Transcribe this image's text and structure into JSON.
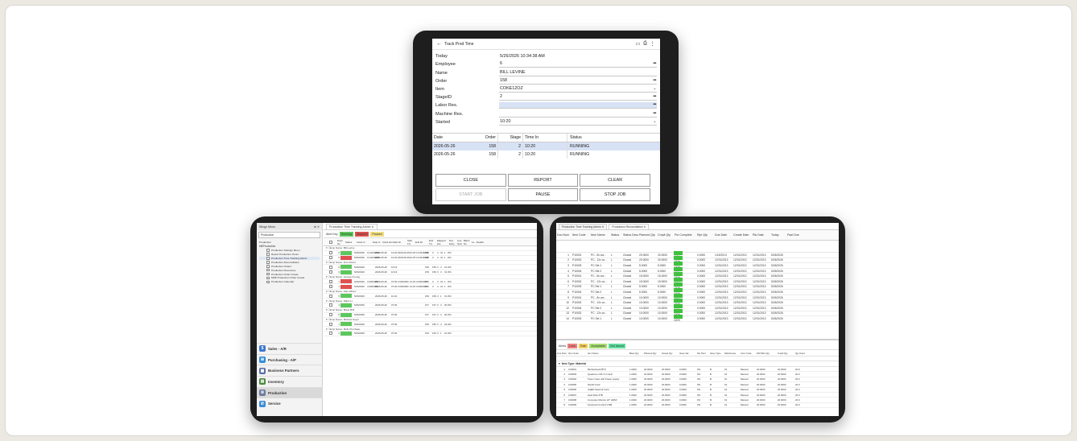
{
  "top_tablet": {
    "title": "Track Prod Time",
    "icons": [
      "barcode-icon",
      "print-icon",
      "more-vertical-icon"
    ],
    "fields": [
      {
        "label": "Today",
        "value": "5/26/2026 10:34:38 AM",
        "suffix": "",
        "style": "plain"
      },
      {
        "label": "Employee",
        "value": "6",
        "suffix": "•••",
        "style": "line"
      },
      {
        "label": "Name",
        "value": "BILL LEVINE",
        "suffix": "",
        "style": "line"
      },
      {
        "label": "Order",
        "value": "158",
        "suffix": "•••",
        "style": "line"
      },
      {
        "label": "Item",
        "value": "COKE12OZ",
        "suffix": "⌄",
        "style": "line"
      },
      {
        "label": "StageID",
        "value": "2",
        "suffix": "•••",
        "style": "line"
      },
      {
        "label": "Labor Res.",
        "value": "",
        "suffix": "•••",
        "style": "hl"
      },
      {
        "label": "Machine Res.",
        "value": "",
        "suffix": "•••",
        "style": "line"
      },
      {
        "label": "Started",
        "value": "10:20",
        "suffix": "⌄",
        "style": "line"
      }
    ],
    "grid": {
      "headers": [
        "Date",
        "Order",
        "Stage",
        "Time In",
        "Status"
      ],
      "rows": [
        [
          "2026-05-26",
          "158",
          "2",
          "10:20",
          "RUNNING"
        ],
        [
          "2026-05-26",
          "158",
          "2",
          "10:20",
          "RUNNING"
        ]
      ]
    },
    "buttons": [
      "CLOSE",
      "REPORT",
      "CLEAR",
      "START JOB",
      "PAUSE",
      "STOP JOB"
    ]
  },
  "left_tablet": {
    "sidebar_title": "Wizgo Menu",
    "sidebar_controls": "⊕ ✕",
    "module_label": "Production",
    "tree_caption": "Production",
    "tree_root": "Production",
    "tree_items": [
      "Production Settings Menu",
      "Report Production Hours",
      "Production Time Tracking Admin",
      "Production Reconciliation",
      "Production Orders",
      "Production Resources",
      "Production Order Create",
      "MRP Production Order Create",
      "Production Calendar"
    ],
    "modules": [
      {
        "label": "Sales - A/R",
        "color": "#3c78c8",
        "glyph": "$"
      },
      {
        "label": "Purchasing - A/P",
        "color": "#2f8ad8",
        "glyph": "⊞"
      },
      {
        "label": "Business Partners",
        "color": "#5b6fa8",
        "glyph": "▦"
      },
      {
        "label": "Inventory",
        "color": "#4a8a3a",
        "glyph": "▤"
      },
      {
        "label": "Production",
        "color": "#6a7c9c",
        "glyph": "⚙"
      },
      {
        "label": "Service",
        "color": "#3a8ad8",
        "glyph": "✆"
      }
    ],
    "tab": "Production Time Tracking Admin",
    "alert_key": "Alert Key",
    "chips": [
      {
        "label": "Running",
        "color": "#5cc85c"
      },
      {
        "label": "Stopped",
        "color": "#e05050"
      },
      {
        "label": "Paused",
        "color": "#f0e080"
      }
    ],
    "headers": [
      "Empl No",
      "Status",
      "Clock In",
      "Date In",
      "Clock Hrs",
      "Start Dt",
      "Start Tm",
      "End Dt",
      "End Tm",
      "Elapsed Hrs",
      "Doc Entry",
      "Line Num",
      "Batch No",
      "Lo...",
      "Dept",
      "Te"
    ],
    "groups": [
      {
        "name": "Emp Name: Bill Levine",
        "rows": [
          {
            "no": "6",
            "status": "#5cc85c",
            "f": [
              "5/26/2026",
              "0.24446000",
              "2026-05-26",
              "10:20",
              "2026-05-26",
              "10:25",
              "0.24446000",
              "158",
              "3",
              "4",
              "31",
              "1",
              "WC"
            ]
          },
          {
            "no": "6",
            "status": "#e05050",
            "f": [
              "5/26/2026",
              "0.24446000",
              "2026-05-26",
              "10:20",
              "2026-05-26",
              "10:25",
              "0.24446000",
              "158",
              "3",
              "4",
              "31",
              "1",
              "WC"
            ]
          }
        ]
      },
      {
        "name": "Emp Name: Fred Rocco",
        "rows": [
          {
            "no": "9",
            "status": "#5cc85c",
            "f": [
              "5/26/2026",
              "",
              "2026-05-26",
              "10:19",
              "",
              "",
              "",
              "159",
              "159",
              "3",
              "4",
              "31",
              "WC"
            ]
          },
          {
            "no": "9",
            "status": "#5cc85c",
            "f": [
              "5/26/2026",
              "",
              "2026-05-26",
              "10:19",
              "",
              "",
              "",
              "159",
              "159",
              "3",
              "4",
              "31",
              "WC"
            ]
          }
        ]
      },
      {
        "name": "Emp Name: George Koenig",
        "rows": [
          {
            "no": "1",
            "status": "#e05050",
            "f": [
              "5/26/2026",
              "3.0000000",
              "2026-05-26",
              "07:00",
              "3.0000000",
              "10:20",
              "3.0000000",
              "159",
              "3",
              "4",
              "31",
              "1",
              "WC"
            ]
          },
          {
            "no": "1",
            "status": "#e05050",
            "f": [
              "5/26/2026",
              "3.0000000",
              "2026-05-26",
              "07:00",
              "3.0000000",
              "10:20",
              "3.0000000",
              "159",
              "3",
              "4",
              "31",
              "1",
              "WC"
            ]
          }
        ]
      },
      {
        "name": "Emp Name: Kate Wilcox",
        "rows": [
          {
            "no": "5",
            "status": "#5cc85c",
            "f": [
              "5/26/2026",
              "",
              "2026-05-26",
              "10:24",
              "",
              "",
              "",
              "159",
              "159",
              "3",
              "1",
              "31",
              "WC"
            ]
          }
        ]
      },
      {
        "name": "Emp Name: Ralph H.",
        "rows": [
          {
            "no": "4",
            "status": "#5cc85c",
            "f": [
              "5/26/2026",
              "",
              "2026-05-26",
              "07:00",
              "",
              "",
              "",
              "157",
              "157",
              "3",
              "4",
              "30",
              "WC"
            ]
          }
        ]
      },
      {
        "name": "Emp Name: Marie Brill",
        "rows": [
          {
            "no": "8",
            "status": "#5cc85c",
            "f": [
              "5/26/2026",
              "",
              "2026-05-26",
              "07:00",
              "",
              "",
              "",
              "157",
              "157",
              "3",
              "4",
              "30",
              "WC"
            ]
          }
        ]
      },
      {
        "name": "Emp Name: Michael Geyer",
        "rows": [
          {
            "no": "1",
            "status": "#5cc85c",
            "f": [
              "5/26/2026",
              "",
              "2026-05-26",
              "07:00",
              "",
              "",
              "",
              "155",
              "155",
              "3",
              "4",
              "32",
              "WC"
            ]
          }
        ]
      },
      {
        "name": "Emp Name: Molly Purchase",
        "rows": [
          {
            "no": "2",
            "status": "#5cc85c",
            "f": [
              "5/26/2026",
              "",
              "2026-05-26",
              "07:00",
              "",
              "",
              "",
              "153",
              "153",
              "3",
              "1",
              "31",
              "WC"
            ]
          }
        ]
      }
    ]
  },
  "right_tablet": {
    "tabs": [
      "Production Time Tracking Admin",
      "Production Reconciliation"
    ],
    "headers": [
      "Doc Num",
      "Item Code",
      "Item Name",
      "Status",
      "Status Desc",
      "Planned Qty",
      "Cmplt Qty",
      "Pct Complete",
      "Rjct Qty",
      "Due Date",
      "Create Date",
      "Rls Date",
      "Today",
      "Past Due"
    ],
    "rows": [
      [
        "1",
        "P10001",
        "PC - 8x cor...",
        "L",
        "Closed",
        "20.0000",
        "20.0000",
        "100%",
        "0.0000",
        "1/15/2013",
        "12/31/2013",
        "12/31/2013",
        "5/26/2026",
        ""
      ],
      [
        "2",
        "P10002",
        "PC - 12x co...",
        "L",
        "Closed",
        "20.0000",
        "20.0000",
        "100%",
        "0.0000",
        "12/31/2013",
        "12/31/2013",
        "12/31/2013",
        "5/26/2026",
        ""
      ],
      [
        "3",
        "P10003",
        "PC Set 1",
        "L",
        "Closed",
        "5.0000",
        "5.0000",
        "100%",
        "0.0000",
        "12/31/2013",
        "12/31/2013",
        "12/31/2013",
        "5/26/2026",
        ""
      ],
      [
        "4",
        "P10004",
        "PC Set 2",
        "L",
        "Closed",
        "5.0000",
        "5.0000",
        "100%",
        "0.0000",
        "12/31/2013",
        "12/31/2013",
        "12/31/2013",
        "5/26/2026",
        ""
      ],
      [
        "5",
        "P10001",
        "PC - 8x cor...",
        "L",
        "Closed",
        "15.0000",
        "15.0000",
        "100%",
        "0.0000",
        "12/31/2013",
        "12/31/2013",
        "12/31/2013",
        "5/26/2026",
        ""
      ],
      [
        "6",
        "P10002",
        "PC - 12x co...",
        "L",
        "Closed",
        "15.0000",
        "15.0000",
        "100%",
        "0.0000",
        "12/31/2013",
        "12/31/2013",
        "12/31/2013",
        "5/26/2026",
        ""
      ],
      [
        "7",
        "P10003",
        "PC Set 1",
        "L",
        "Closed",
        "5.0000",
        "5.0000",
        "100%",
        "0.0000",
        "12/31/2013",
        "12/31/2013",
        "12/31/2013",
        "5/26/2026",
        ""
      ],
      [
        "8",
        "P10004",
        "PC Set 2",
        "L",
        "Closed",
        "5.0000",
        "5.0000",
        "100%",
        "0.0000",
        "12/31/2013",
        "12/31/2013",
        "12/31/2013",
        "5/26/2026",
        ""
      ],
      [
        "9",
        "P10001",
        "PC - 8x cor...",
        "L",
        "Closed",
        "10.0000",
        "10.0000",
        "100%",
        "0.0000",
        "12/31/2013",
        "12/31/2013",
        "12/31/2013",
        "5/26/2026",
        ""
      ],
      [
        "10",
        "P10002",
        "PC - 12x co...",
        "L",
        "Closed",
        "10.0000",
        "10.0000",
        "100%",
        "0.0000",
        "12/31/2013",
        "12/31/2013",
        "12/31/2013",
        "5/26/2026",
        ""
      ],
      [
        "12",
        "P10004",
        "PC Set 2",
        "L",
        "Closed",
        "10.0000",
        "10.0000",
        "100%",
        "0.0000",
        "12/31/2013",
        "12/31/2013",
        "12/31/2013",
        "5/26/2026",
        ""
      ],
      [
        "13",
        "P10002",
        "PC - 12x co...",
        "L",
        "Closed",
        "10.0000",
        "10.0000",
        "100%",
        "0.0000",
        "12/31/2013",
        "12/31/2013",
        "12/31/2013",
        "5/26/2026",
        ""
      ],
      [
        "14",
        "P10003",
        "PC Set 1",
        "L",
        "Closed",
        "10.0000",
        "10.0000",
        "100%",
        "0.0000",
        "12/31/2013",
        "12/31/2013",
        "12/31/2013",
        "5/26/2026",
        ""
      ]
    ],
    "alerts_label": "Alerts",
    "chips": [
      {
        "label": "Loss",
        "color": "#f08080"
      },
      {
        "label": "Gain",
        "color": "#f5d060"
      },
      {
        "label": "Acceptable",
        "color": "#a8e070"
      },
      {
        "label": "Not Issued",
        "color": "#60e0a0"
      }
    ],
    "lower_headers": [
      "Line Num",
      "Item Code",
      "Item Name",
      "Base Qty",
      "Planned Qty",
      "Issued Qty",
      "Issue Var",
      "Var Pent",
      "Issue Type",
      "Warehouse",
      "Uom Code",
      "Dtd Plan Qty",
      "Cmplt Qty",
      "Qty Used"
    ],
    "group": "Item Type: Material",
    "lower_rows": [
      [
        "1",
        "C00001",
        "Motherboard BTX",
        "1.0000",
        "20.0000",
        "20.0000",
        "0.0000",
        "0%",
        "B",
        "01",
        "Manual",
        "20.0000",
        "20.0000",
        "20.0"
      ],
      [
        "2",
        "C00003",
        "Quadcore CPU 3.4 GHz",
        "1.0000",
        "20.0000",
        "20.0000",
        "0.0000",
        "0%",
        "B",
        "01",
        "Manual",
        "20.0000",
        "20.0000",
        "20.0"
      ],
      [
        "3",
        "C00004",
        "Tower Case with Power supply",
        "1.0000",
        "20.0000",
        "20.0000",
        "0.0000",
        "0%",
        "B",
        "01",
        "Manual",
        "20.0000",
        "20.0000",
        "20.0"
      ],
      [
        "4",
        "C00005",
        "WLAN Card",
        "1.0000",
        "20.0000",
        "20.0000",
        "0.0000",
        "0%",
        "B",
        "01",
        "Manual",
        "20.0000",
        "20.0000",
        "20.0"
      ],
      [
        "5",
        "C00006",
        "GigBit Network Card",
        "1.0000",
        "20.0000",
        "20.0000",
        "0.0000",
        "0%",
        "B",
        "01",
        "Manual",
        "20.0000",
        "20.0000",
        "20.0"
      ],
      [
        "6",
        "C00007",
        "Hard Disk 3TB",
        "1.0000",
        "20.0000",
        "20.0000",
        "0.0000",
        "0%",
        "B",
        "01",
        "Manual",
        "20.0000",
        "20.0000",
        "20.0"
      ],
      [
        "7",
        "C00008",
        "Computer Monitor 24\" HDMI",
        "1.0000",
        "20.0000",
        "20.0000",
        "0.0000",
        "0%",
        "B",
        "01",
        "Manual",
        "20.0000",
        "20.0000",
        "20.0"
      ],
      [
        "8",
        "C00009",
        "Keyboard Comfort USB",
        "1.0000",
        "20.0000",
        "20.0000",
        "0.0000",
        "0%",
        "B",
        "01",
        "Manual",
        "20.0000",
        "20.0000",
        "20.0"
      ]
    ]
  }
}
